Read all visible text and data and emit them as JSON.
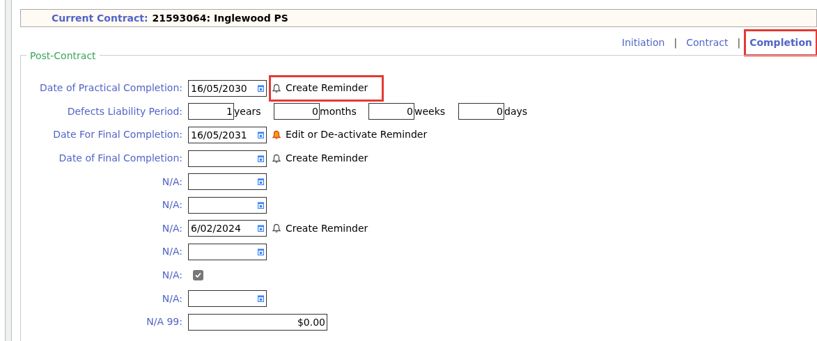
{
  "header": {
    "label": "Current Contract:",
    "value": "21593064: Inglewood PS"
  },
  "nav": [
    {
      "label": "Initiation",
      "selected": false,
      "highlighted": false
    },
    {
      "label": "Contract",
      "selected": false,
      "highlighted": false
    },
    {
      "label": "Completion",
      "selected": true,
      "highlighted": true
    }
  ],
  "nav_separator": "|",
  "section": {
    "legend": "Post-Contract",
    "rows": [
      {
        "kind": "date",
        "label": "Date of Practical Completion:",
        "value": "16/05/2030",
        "reminder": {
          "text": "Create Reminder",
          "active": false,
          "highlighted": true
        }
      },
      {
        "kind": "period",
        "label": "Defects Liability Period:",
        "parts": [
          {
            "value": "1",
            "unit": "years"
          },
          {
            "value": "0",
            "unit": "months"
          },
          {
            "value": "0",
            "unit": "weeks"
          },
          {
            "value": "0",
            "unit": "days"
          }
        ]
      },
      {
        "kind": "date",
        "label": "Date For Final Completion:",
        "value": "16/05/2031",
        "reminder": {
          "text": "Edit or De-activate Reminder",
          "active": true,
          "highlighted": false
        }
      },
      {
        "kind": "date",
        "label": "Date of Final Completion:",
        "reminder": {
          "text": "Create Reminder",
          "active": false,
          "highlighted": false
        }
      },
      {
        "kind": "date",
        "label": "N/A:"
      },
      {
        "kind": "date",
        "label": "N/A:"
      },
      {
        "kind": "date",
        "label": "N/A:",
        "value": "6/02/2024",
        "reminder": {
          "text": "Create Reminder",
          "active": false,
          "highlighted": false
        }
      },
      {
        "kind": "date",
        "label": "N/A:"
      },
      {
        "kind": "checkbox",
        "label": "N/A:",
        "checked": true
      },
      {
        "kind": "date",
        "label": "N/A:"
      },
      {
        "kind": "currency",
        "label": "N/A 99:",
        "value": "$0.00"
      }
    ]
  }
}
